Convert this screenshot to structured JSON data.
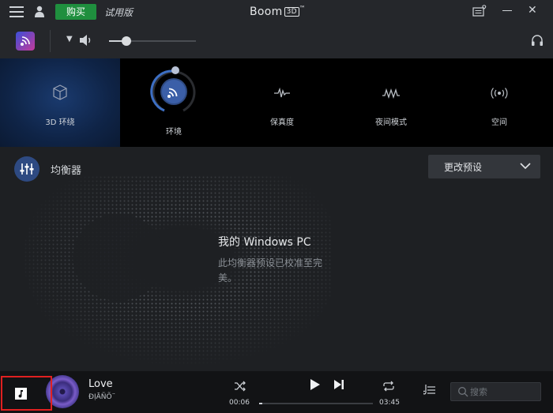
{
  "titlebar": {
    "buy_label": "购买",
    "trial_label": "试用版",
    "app_name": "Boom",
    "app_badge": "3D",
    "app_tm": "™"
  },
  "volume": {
    "level": 0.2
  },
  "effects": [
    {
      "label": "3D 环绕",
      "icon": "cube-icon",
      "active": true
    },
    {
      "label": "环境",
      "icon": "ambience-icon",
      "active": true
    },
    {
      "label": "保真度",
      "icon": "waveform-icon",
      "active": false
    },
    {
      "label": "夜间模式",
      "icon": "night-wave-icon",
      "active": false
    },
    {
      "label": "空间",
      "icon": "spatial-icon",
      "active": false
    }
  ],
  "equalizer": {
    "title": "均衡器",
    "preset_dropdown_label": "更改预设",
    "preset_name": "我的 Windows PC",
    "preset_description": "此均衡器预设已校准至完美。"
  },
  "player": {
    "track_title": "Love",
    "track_artist": "ĐỊĀÑÕ¨",
    "time_current": "00:06",
    "time_total": "03:45",
    "progress": 0.027,
    "search_placeholder": "搜索"
  },
  "colors": {
    "accent_blue": "#2e4a82",
    "buy_green": "#1f8f3e",
    "highlight_red": "#e02020"
  }
}
